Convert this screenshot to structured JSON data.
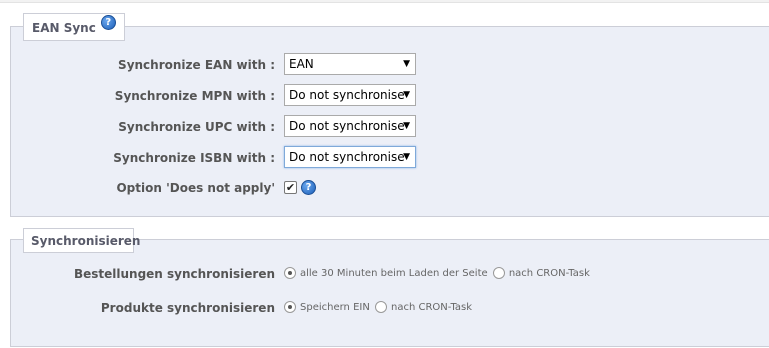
{
  "ean_panel": {
    "legend": "EAN Sync",
    "help_icon": "question-help-icon",
    "rows": [
      {
        "label": "Synchronize EAN with :",
        "value": "EAN"
      },
      {
        "label": "Synchronize MPN with :",
        "value": "Do not synchronise"
      },
      {
        "label": "Synchronize UPC with :",
        "value": "Do not synchronise"
      },
      {
        "label": "Synchronize ISBN with :",
        "value": "Do not synchronise"
      }
    ],
    "option_label": "Option 'Does not apply'",
    "option_checked": true
  },
  "sync_panel": {
    "legend": "Synchronisieren",
    "orders": {
      "label": "Bestellungen synchronisieren",
      "options": [
        "alle 30 Minuten beim Laden der Seite",
        "nach CRON-Task"
      ],
      "selected": 0
    },
    "products": {
      "label": "Produkte synchronisieren",
      "options": [
        "Speichern EIN",
        "nach CRON-Task"
      ],
      "selected": 0
    }
  },
  "colors": {
    "panel_bg": "#eceff7",
    "panel_border": "#ccced7",
    "legend_text": "#585a69",
    "help_blue": "#1c5fb8"
  }
}
